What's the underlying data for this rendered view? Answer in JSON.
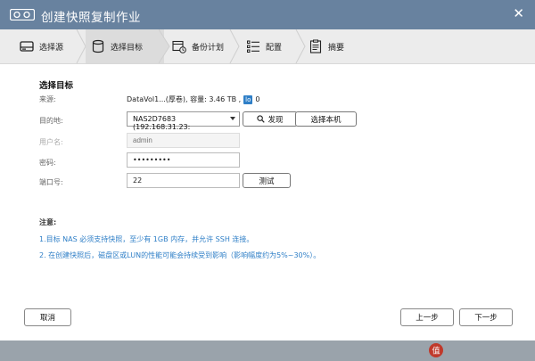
{
  "window": {
    "title": "创建快照复制作业"
  },
  "steps": [
    {
      "label": "选择源"
    },
    {
      "label": "选择目标"
    },
    {
      "label": "备份计划"
    },
    {
      "label": "配置"
    },
    {
      "label": "摘要"
    }
  ],
  "form": {
    "section_title": "选择目标",
    "source_label": "来源:",
    "source_value": "DataVol1...(厚卷), 容量: 3.46 TB ,",
    "source_badge": "lo",
    "source_count": "0",
    "destination_label": "目的地:",
    "destination_value": "NAS2D7683 (192.168.31.23:",
    "discover_label": "发现",
    "select_local_label": "选择本机",
    "username_label": "用户名:",
    "username_placeholder": "admin",
    "password_label": "密码:",
    "password_value": "•••••••••",
    "port_label": "端口号:",
    "port_value": "22",
    "test_label": "测试"
  },
  "notes": {
    "title": "注意:",
    "items": [
      "1.目标 NAS 必须支持快照，至少有 1GB 内存，并允许 SSH 连接。",
      "2. 在创建快照后，磁盘区或LUN的性能可能会持续受到影响（影响幅度约为5%~30%）。"
    ]
  },
  "footer": {
    "cancel_label": "取消",
    "prev_label": "上一步",
    "next_label": "下一步"
  },
  "colors": {
    "titlebar": "#68829f",
    "accent": "#2f7fc7"
  }
}
